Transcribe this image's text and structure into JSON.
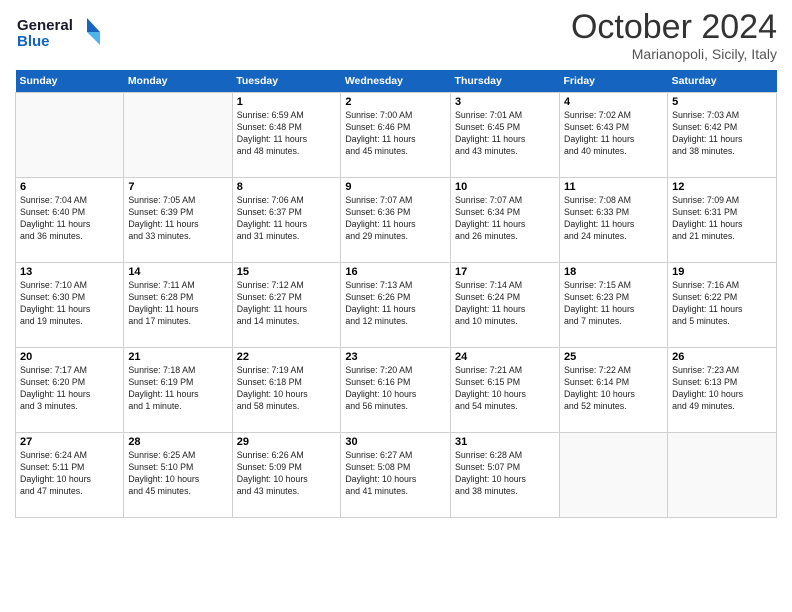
{
  "header": {
    "logo_line1": "General",
    "logo_line2": "Blue",
    "month": "October 2024",
    "location": "Marianopoli, Sicily, Italy"
  },
  "weekdays": [
    "Sunday",
    "Monday",
    "Tuesday",
    "Wednesday",
    "Thursday",
    "Friday",
    "Saturday"
  ],
  "weeks": [
    [
      {
        "day": "",
        "info": ""
      },
      {
        "day": "",
        "info": ""
      },
      {
        "day": "1",
        "info": "Sunrise: 6:59 AM\nSunset: 6:48 PM\nDaylight: 11 hours\nand 48 minutes."
      },
      {
        "day": "2",
        "info": "Sunrise: 7:00 AM\nSunset: 6:46 PM\nDaylight: 11 hours\nand 45 minutes."
      },
      {
        "day": "3",
        "info": "Sunrise: 7:01 AM\nSunset: 6:45 PM\nDaylight: 11 hours\nand 43 minutes."
      },
      {
        "day": "4",
        "info": "Sunrise: 7:02 AM\nSunset: 6:43 PM\nDaylight: 11 hours\nand 40 minutes."
      },
      {
        "day": "5",
        "info": "Sunrise: 7:03 AM\nSunset: 6:42 PM\nDaylight: 11 hours\nand 38 minutes."
      }
    ],
    [
      {
        "day": "6",
        "info": "Sunrise: 7:04 AM\nSunset: 6:40 PM\nDaylight: 11 hours\nand 36 minutes."
      },
      {
        "day": "7",
        "info": "Sunrise: 7:05 AM\nSunset: 6:39 PM\nDaylight: 11 hours\nand 33 minutes."
      },
      {
        "day": "8",
        "info": "Sunrise: 7:06 AM\nSunset: 6:37 PM\nDaylight: 11 hours\nand 31 minutes."
      },
      {
        "day": "9",
        "info": "Sunrise: 7:07 AM\nSunset: 6:36 PM\nDaylight: 11 hours\nand 29 minutes."
      },
      {
        "day": "10",
        "info": "Sunrise: 7:07 AM\nSunset: 6:34 PM\nDaylight: 11 hours\nand 26 minutes."
      },
      {
        "day": "11",
        "info": "Sunrise: 7:08 AM\nSunset: 6:33 PM\nDaylight: 11 hours\nand 24 minutes."
      },
      {
        "day": "12",
        "info": "Sunrise: 7:09 AM\nSunset: 6:31 PM\nDaylight: 11 hours\nand 21 minutes."
      }
    ],
    [
      {
        "day": "13",
        "info": "Sunrise: 7:10 AM\nSunset: 6:30 PM\nDaylight: 11 hours\nand 19 minutes."
      },
      {
        "day": "14",
        "info": "Sunrise: 7:11 AM\nSunset: 6:28 PM\nDaylight: 11 hours\nand 17 minutes."
      },
      {
        "day": "15",
        "info": "Sunrise: 7:12 AM\nSunset: 6:27 PM\nDaylight: 11 hours\nand 14 minutes."
      },
      {
        "day": "16",
        "info": "Sunrise: 7:13 AM\nSunset: 6:26 PM\nDaylight: 11 hours\nand 12 minutes."
      },
      {
        "day": "17",
        "info": "Sunrise: 7:14 AM\nSunset: 6:24 PM\nDaylight: 11 hours\nand 10 minutes."
      },
      {
        "day": "18",
        "info": "Sunrise: 7:15 AM\nSunset: 6:23 PM\nDaylight: 11 hours\nand 7 minutes."
      },
      {
        "day": "19",
        "info": "Sunrise: 7:16 AM\nSunset: 6:22 PM\nDaylight: 11 hours\nand 5 minutes."
      }
    ],
    [
      {
        "day": "20",
        "info": "Sunrise: 7:17 AM\nSunset: 6:20 PM\nDaylight: 11 hours\nand 3 minutes."
      },
      {
        "day": "21",
        "info": "Sunrise: 7:18 AM\nSunset: 6:19 PM\nDaylight: 11 hours\nand 1 minute."
      },
      {
        "day": "22",
        "info": "Sunrise: 7:19 AM\nSunset: 6:18 PM\nDaylight: 10 hours\nand 58 minutes."
      },
      {
        "day": "23",
        "info": "Sunrise: 7:20 AM\nSunset: 6:16 PM\nDaylight: 10 hours\nand 56 minutes."
      },
      {
        "day": "24",
        "info": "Sunrise: 7:21 AM\nSunset: 6:15 PM\nDaylight: 10 hours\nand 54 minutes."
      },
      {
        "day": "25",
        "info": "Sunrise: 7:22 AM\nSunset: 6:14 PM\nDaylight: 10 hours\nand 52 minutes."
      },
      {
        "day": "26",
        "info": "Sunrise: 7:23 AM\nSunset: 6:13 PM\nDaylight: 10 hours\nand 49 minutes."
      }
    ],
    [
      {
        "day": "27",
        "info": "Sunrise: 6:24 AM\nSunset: 5:11 PM\nDaylight: 10 hours\nand 47 minutes."
      },
      {
        "day": "28",
        "info": "Sunrise: 6:25 AM\nSunset: 5:10 PM\nDaylight: 10 hours\nand 45 minutes."
      },
      {
        "day": "29",
        "info": "Sunrise: 6:26 AM\nSunset: 5:09 PM\nDaylight: 10 hours\nand 43 minutes."
      },
      {
        "day": "30",
        "info": "Sunrise: 6:27 AM\nSunset: 5:08 PM\nDaylight: 10 hours\nand 41 minutes."
      },
      {
        "day": "31",
        "info": "Sunrise: 6:28 AM\nSunset: 5:07 PM\nDaylight: 10 hours\nand 38 minutes."
      },
      {
        "day": "",
        "info": ""
      },
      {
        "day": "",
        "info": ""
      }
    ]
  ]
}
